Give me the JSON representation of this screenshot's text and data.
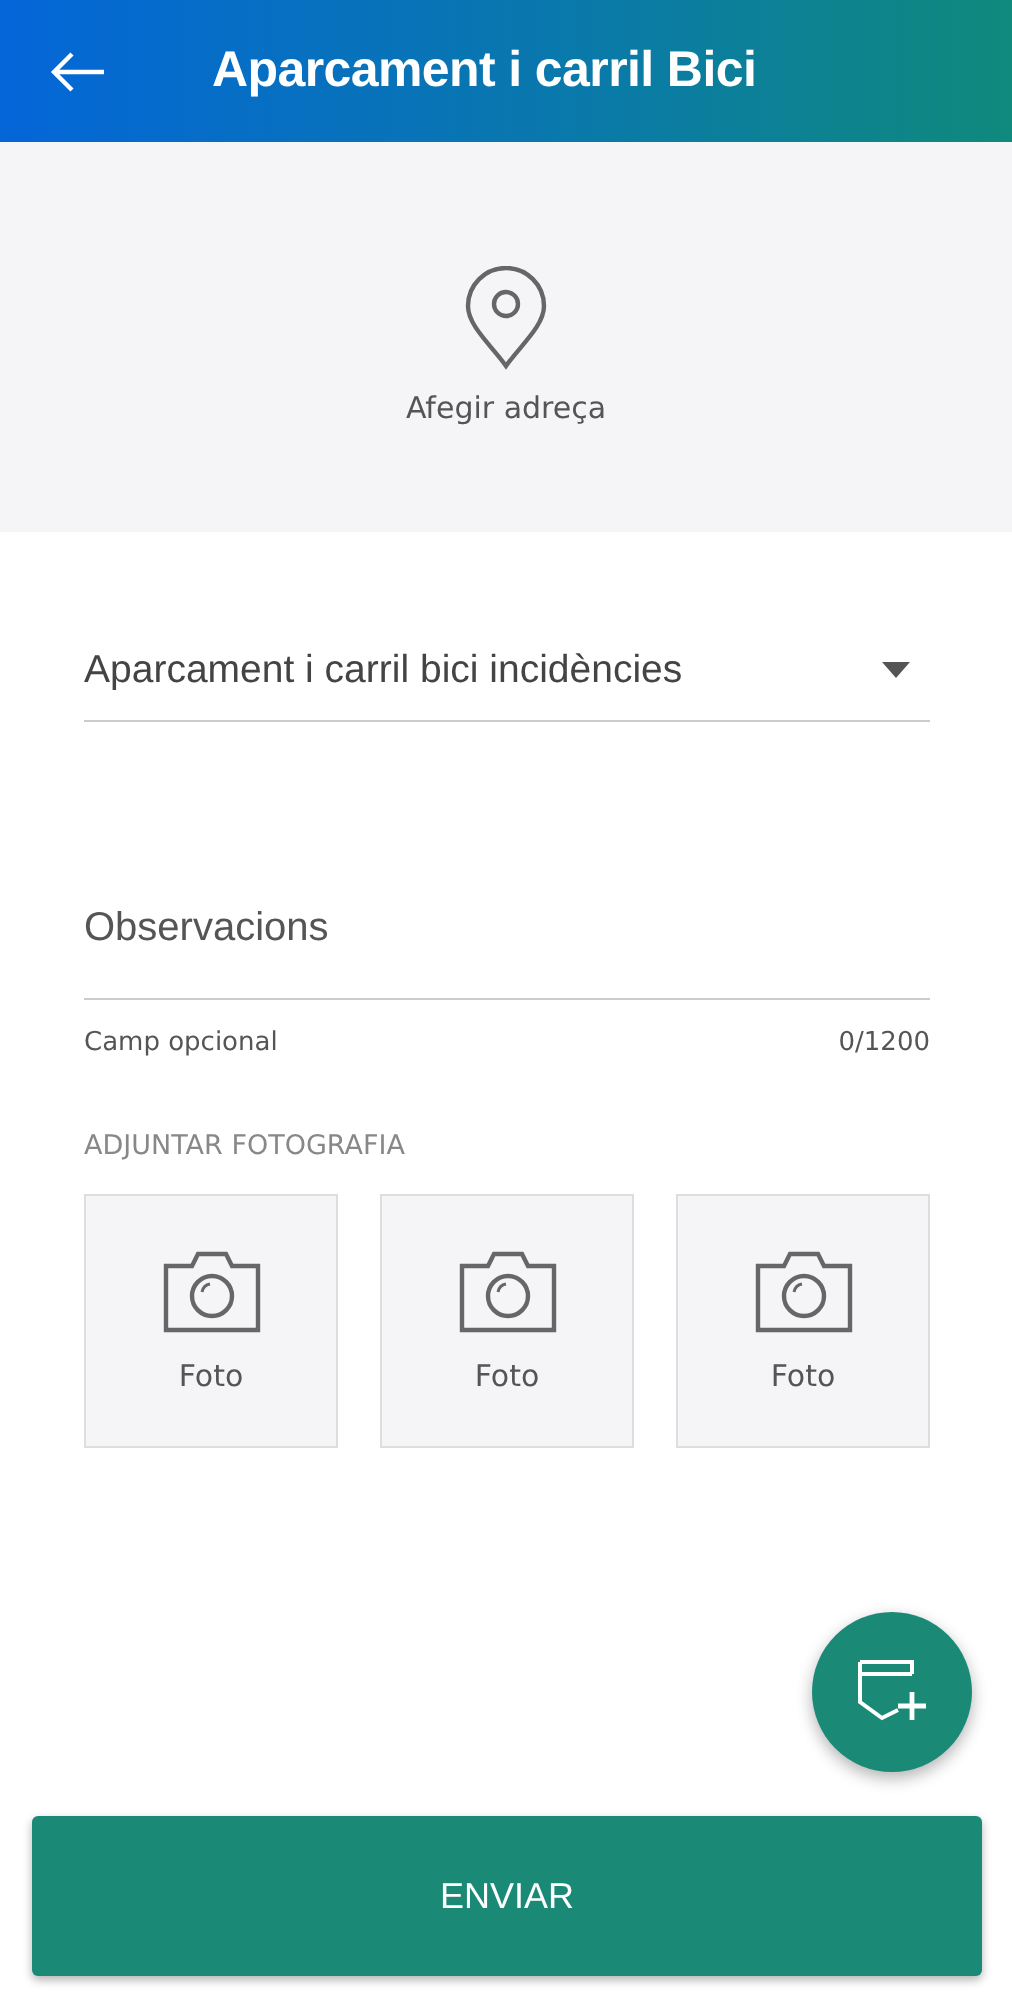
{
  "header": {
    "title": "Aparcament i carril Bici"
  },
  "address": {
    "label": "Afegir adreça"
  },
  "category": {
    "value": "Aparcament i carril bici incidències"
  },
  "observations": {
    "placeholder": "Observacions",
    "helper": "Camp opcional",
    "counter": "0/1200"
  },
  "photos": {
    "label": "ADJUNTAR FOTOGRAFIA",
    "items": [
      {
        "label": "Foto"
      },
      {
        "label": "Foto"
      },
      {
        "label": "Foto"
      }
    ]
  },
  "submit": {
    "label": "ENVIAR"
  }
}
